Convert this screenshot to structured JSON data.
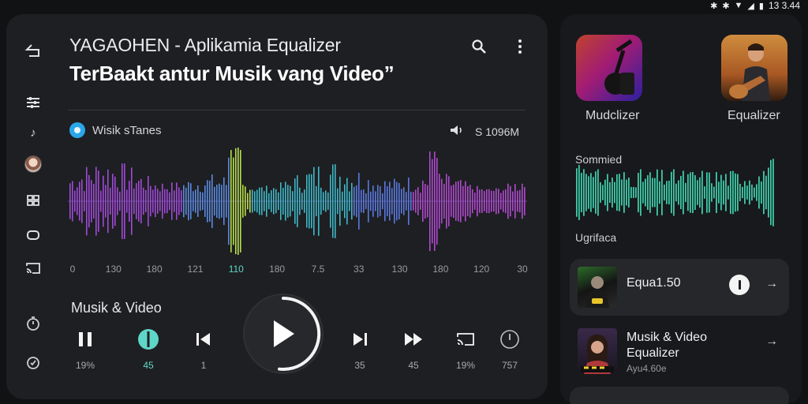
{
  "status_bar": {
    "time": "13 3.44",
    "icons": [
      "bluetooth-icon",
      "bluetooth-icon",
      "wifi-icon",
      "signal-icon",
      "battery-icon"
    ]
  },
  "header": {
    "title_line1": "YAGAOHEN - Aplikamia Equalizer",
    "title_line2": "TerBaakt antur Musik vang Video”",
    "actions": [
      "search-icon",
      "more-vertical-icon"
    ]
  },
  "side_rail": [
    "back-icon",
    "sliders-icon",
    "music-note-icon",
    "avatar",
    "grid-icon",
    "loop-icon",
    "cast-icon",
    "timer-icon",
    "check-circle-icon"
  ],
  "source": {
    "label": "Wisik sTanes",
    "volume_value": "S 1096M"
  },
  "waveform_axis": [
    "0",
    "130",
    "180",
    "121",
    "110",
    "180",
    "7.5",
    "33",
    "130",
    "180",
    "120",
    "30"
  ],
  "section_label": "Musik & Video",
  "controls": [
    {
      "icon": "pause-icon",
      "label": "19%"
    },
    {
      "icon": "equalizer-toggle-icon",
      "label": "45"
    },
    {
      "icon": "skip-previous-icon",
      "label": "1"
    },
    {
      "icon": "skip-next-icon",
      "label": "35"
    },
    {
      "icon": "fast-forward-icon",
      "label": "45"
    },
    {
      "icon": "cast-icon",
      "label": "19%"
    },
    {
      "icon": "power-icon",
      "label": "757"
    }
  ],
  "right_panel": {
    "apps": [
      {
        "label": "Mudclizer",
        "icon": "guitar-icon"
      },
      {
        "label": "Equalizer",
        "icon": "guitarist-photo"
      }
    ],
    "wave_top_label": "Sommied",
    "wave_bottom_label": "Ugrifaca",
    "list": [
      {
        "title": "Equa1.50",
        "subtitle": ""
      },
      {
        "title": "Musik & Video Equalizer",
        "subtitle": "Ayu4.60e"
      }
    ]
  },
  "colors": {
    "accent": "#5fd6c8",
    "card": "#1e1f22",
    "panel": "#18191c",
    "background": "#111214"
  }
}
